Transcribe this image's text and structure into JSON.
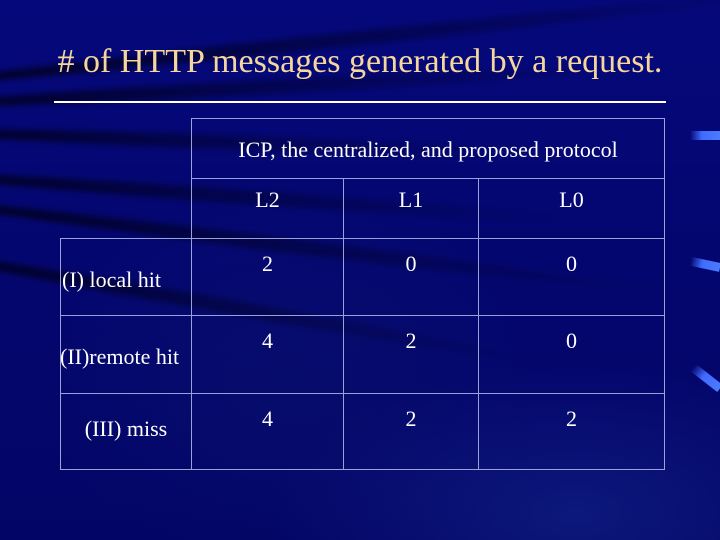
{
  "slide": {
    "title": "# of HTTP messages generated by a request.",
    "title_color": "#f5d79d",
    "background_color": "#03036b"
  },
  "table": {
    "group_header": "ICP, the centralized, and proposed protocol",
    "columns": [
      "L2",
      "L1",
      "L0"
    ],
    "rows": [
      {
        "label": "(I) local hit",
        "values": [
          "2",
          "0",
          "0"
        ]
      },
      {
        "label": "(II)remote hit",
        "values": [
          "4",
          "2",
          "0"
        ]
      },
      {
        "label": "(III) miss",
        "values": [
          "4",
          "2",
          "2"
        ]
      }
    ]
  }
}
